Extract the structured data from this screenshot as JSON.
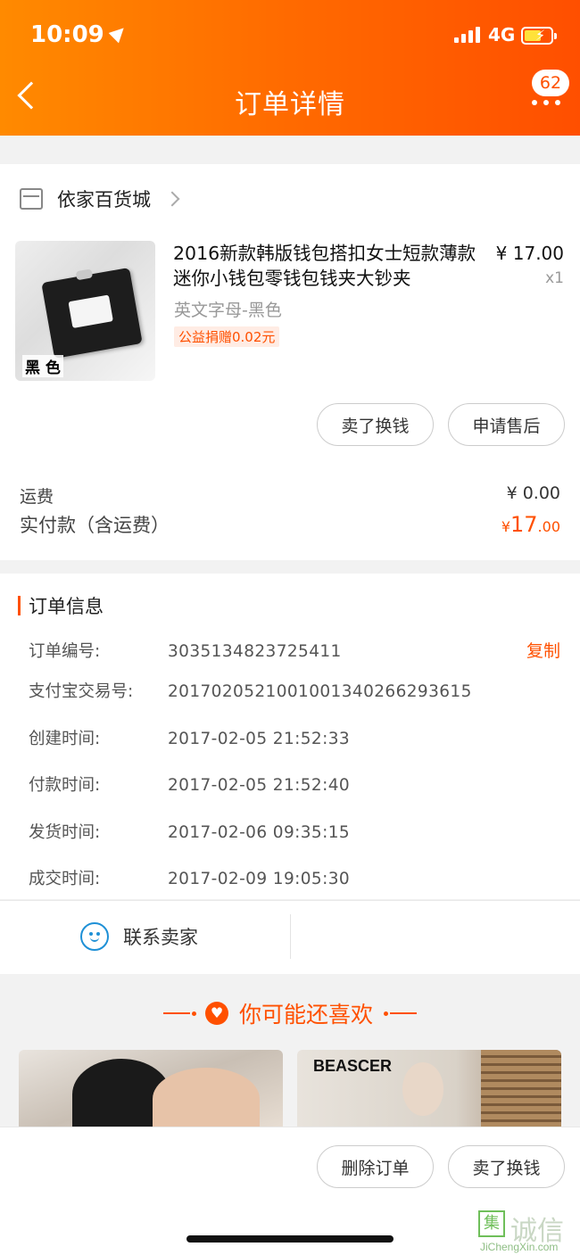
{
  "status_bar": {
    "time": "10:09",
    "network": "4G"
  },
  "header": {
    "title": "订单详情",
    "badge_count": "62"
  },
  "store": {
    "name": "依家百货城"
  },
  "product": {
    "title": "2016新款韩版钱包搭扣女士短款薄款迷你小钱包零钱包钱夹大钞夹",
    "price": "¥ 17.00",
    "quantity": "x1",
    "variant": "英文字母-黑色",
    "charity_tag": "公益捐赠0.02元",
    "thumb_tag": "黑 色"
  },
  "item_actions": {
    "sell": "卖了换钱",
    "after_sale": "申请售后"
  },
  "summary": {
    "shipping_label": "运费",
    "shipping_value": "¥ 0.00",
    "paid_label": "实付款（含运费）",
    "paid_currency": "¥",
    "paid_int": "17",
    "paid_dec": ".00"
  },
  "order_info": {
    "title": "订单信息",
    "copy_label": "复制",
    "rows": [
      {
        "key": "订单编号:",
        "value": "3035134823725411"
      },
      {
        "key": "支付宝交易号:",
        "value": "2017020521001001340266293615"
      },
      {
        "key": "创建时间:",
        "value": "2017-02-05 21:52:33"
      },
      {
        "key": "付款时间:",
        "value": "2017-02-05 21:52:40"
      },
      {
        "key": "发货时间:",
        "value": "2017-02-06 09:35:15"
      },
      {
        "key": "成交时间:",
        "value": "2017-02-09 19:05:30"
      }
    ]
  },
  "contact": {
    "label": "联系卖家"
  },
  "recommend": {
    "title": "你可能还喜欢",
    "brand_text": "BEASCER"
  },
  "bottom_actions": {
    "delete": "删除订单",
    "sell": "卖了换钱"
  },
  "watermark": {
    "logo": "集",
    "text": "诚信",
    "url": "JiChengXin.com"
  },
  "colors": {
    "accent": "#ff5000",
    "header_start": "#ff8a00",
    "header_end": "#ff4f00",
    "contact_blue": "#1e90d6"
  }
}
